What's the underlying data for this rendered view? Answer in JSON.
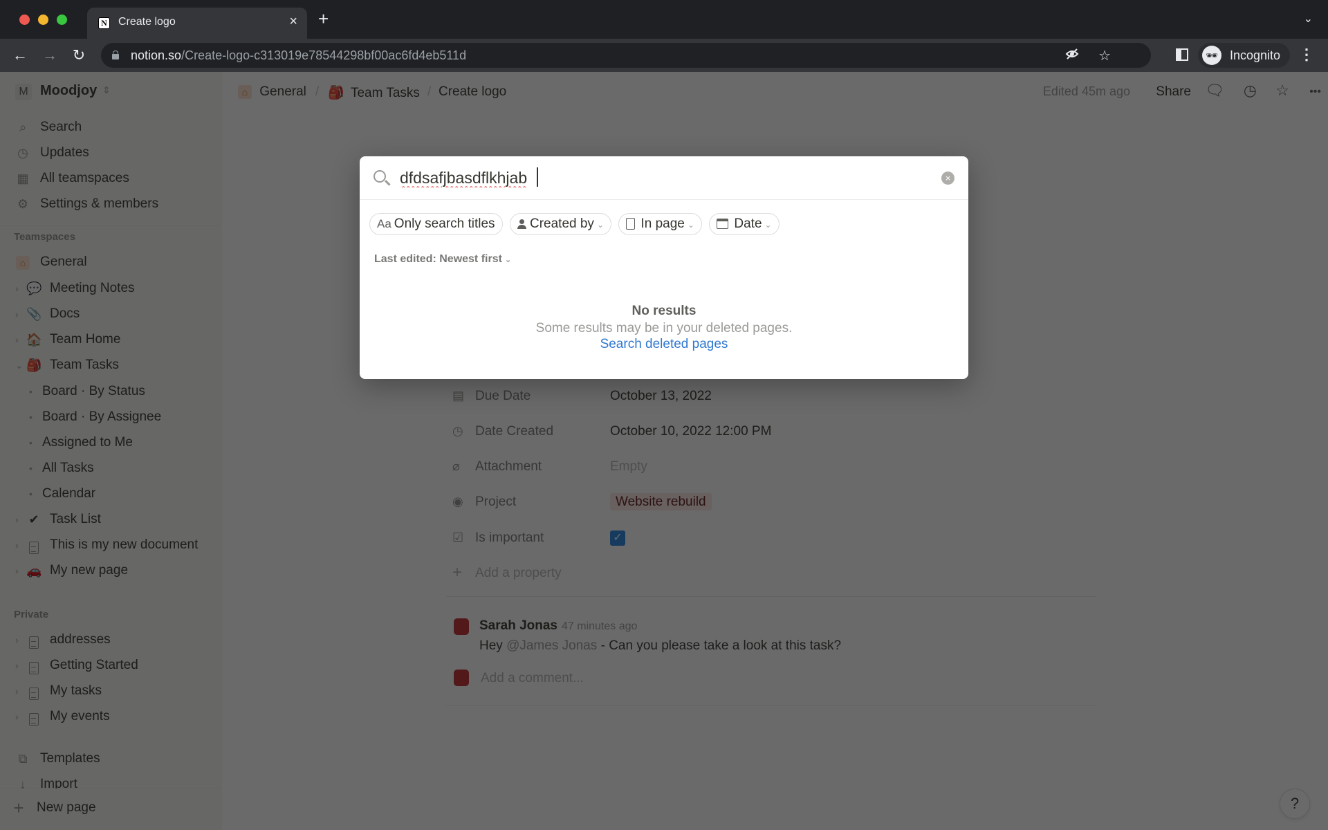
{
  "browser": {
    "tab_title": "Create logo",
    "favicon_letter": "N",
    "tab_close": "×",
    "new_tab": "+",
    "tab_list": "⌄",
    "url_host": "notion.so",
    "url_path": "/Create-logo-c313019e78544298bf00ac6fd4eb511d",
    "profile_label": "Incognito",
    "icons": {
      "back": "←",
      "forward": "→",
      "reload": "↻",
      "eye_off": "◌",
      "star": "☆",
      "incognito": "🕶",
      "menu": "⋮"
    }
  },
  "sidebar": {
    "workspace": {
      "avatar_letter": "M",
      "name": "Moodjoy",
      "switch_icon": "⇕"
    },
    "top_items": [
      {
        "label": "Search",
        "icon": "⌕"
      },
      {
        "label": "Updates",
        "icon": "◷"
      },
      {
        "label": "All teamspaces",
        "icon": "▦"
      },
      {
        "label": "Settings & members",
        "icon": "⚙"
      }
    ],
    "teamspaces_heading": "Teamspaces",
    "teamspace_root": {
      "label": "General",
      "icon": "⌂"
    },
    "teamspace_items": [
      {
        "label": "Meeting Notes",
        "icon": "💬",
        "chevron": "›"
      },
      {
        "label": "Docs",
        "icon": "📎",
        "chevron": "›"
      },
      {
        "label": "Team Home",
        "icon": "🏠",
        "chevron": "›"
      },
      {
        "label": "Team Tasks",
        "icon": "🎒",
        "chevron": "⌄"
      }
    ],
    "team_tasks_views": [
      {
        "label": "Board · By Status"
      },
      {
        "label": "Board · By Assignee"
      },
      {
        "label": "Assigned to Me"
      },
      {
        "label": "All Tasks"
      },
      {
        "label": "Calendar"
      }
    ],
    "teamspace_more": [
      {
        "label": "Task List",
        "icon": "✔",
        "chevron": "›"
      },
      {
        "label": "This is my new document",
        "icon": "doc",
        "chevron": "›"
      },
      {
        "label": "My new page",
        "icon": "🚗",
        "chevron": "›"
      }
    ],
    "private_heading": "Private",
    "private_items": [
      {
        "label": "addresses",
        "chevron": "›"
      },
      {
        "label": "Getting Started",
        "chevron": "›"
      },
      {
        "label": "My tasks",
        "chevron": "›"
      },
      {
        "label": "My events",
        "chevron": "›"
      }
    ],
    "templates_label": "Templates",
    "templates_icon": "⧉",
    "import_label": "Import",
    "import_icon": "↓",
    "new_page_label": "New page",
    "new_page_icon": "+"
  },
  "topbar": {
    "breadcrumbs": [
      {
        "label": "General",
        "icon": "⌂"
      },
      {
        "label": "Team Tasks",
        "icon": "🎒"
      },
      {
        "label": "Create logo"
      }
    ],
    "separator": "/",
    "edited": "Edited 45m ago",
    "share_label": "Share",
    "icons": {
      "comments": "🗨",
      "history": "◷",
      "favorite": "☆",
      "more": "•••"
    }
  },
  "page": {
    "properties": [
      {
        "name": "Due Date",
        "icon": "▤",
        "value": "October 13, 2022"
      },
      {
        "name": "Date Created",
        "icon": "◷",
        "value": "October 10, 2022 12:00 PM"
      },
      {
        "name": "Attachment",
        "icon": "⌀",
        "value": "Empty"
      },
      {
        "name": "Project",
        "icon": "◉",
        "value": "Website rebuild"
      },
      {
        "name": "Is important",
        "icon": "☑",
        "checked": true,
        "check_glyph": "✓"
      }
    ],
    "add_property_label": "Add a property",
    "add_property_icon": "+",
    "comment": {
      "author": "Sarah Jonas",
      "time": "47 minutes ago",
      "text_prefix": "Hey ",
      "mention": "@James Jonas",
      "text_suffix": " - Can you please take a look at this task?"
    },
    "add_comment_placeholder": "Add a comment...",
    "help_label": "?"
  },
  "search_modal": {
    "query": "dfdsafjbasdflkhjab",
    "clear_icon": "×",
    "filters": [
      {
        "label": "Only search titles",
        "icon": "Aa"
      },
      {
        "label": "Created by",
        "icon": "person",
        "chevron": "⌄"
      },
      {
        "label": "In page",
        "icon": "page",
        "chevron": "⌄"
      },
      {
        "label": "Date",
        "icon": "calendar",
        "chevron": "⌄"
      }
    ],
    "sort_label": "Last edited: Newest first",
    "sort_chevron": "⌄",
    "no_results_title": "No results",
    "no_results_subtitle": "Some results may be in your deleted pages.",
    "search_deleted_link": "Search deleted pages"
  }
}
